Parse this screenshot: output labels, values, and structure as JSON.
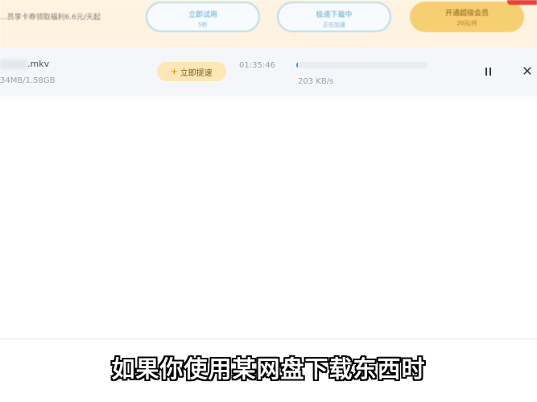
{
  "banner": {
    "text": "...员享卡券领取福利6.6元/天起",
    "buttons": [
      {
        "label": "立即试用",
        "sub": "5秒"
      },
      {
        "label": "极速下载中",
        "sub": "正在加速"
      },
      {
        "label": "开通超级会员",
        "sub": "20元/月"
      }
    ]
  },
  "download": {
    "file_name": ".mkv",
    "size_progress": "34MB/1.58GB",
    "speedup_label": "立即提速",
    "time_remaining": "01:35:46",
    "speed": "203 KB/s",
    "progress": 0.01
  },
  "controls": {
    "pause_icon": "pause-icon",
    "close_icon": "close-icon"
  },
  "subtitle": "如果你使用某网盘下载东西时",
  "colors": {
    "banner_bg": "#fdf3e0",
    "accent_blue": "#3d8ff5",
    "gold": "#f6cf72"
  }
}
